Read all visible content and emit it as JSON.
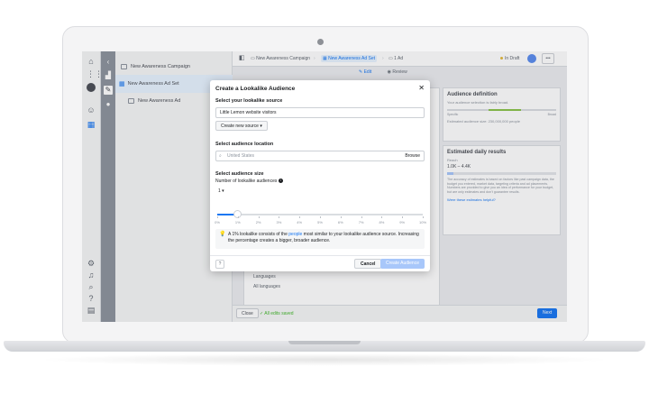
{
  "tree": {
    "campaign": "New Awareness Campaign",
    "adset": "New Awareness Ad Set",
    "ad": "New Awareness Ad"
  },
  "topbar": {
    "crumb_campaign": "New Awareness Campaign",
    "crumb_adset": "New Awareness Ad Set",
    "crumb_ad": "1 Ad",
    "status": "In Draft",
    "more": "•••"
  },
  "tabs": {
    "edit": "Edit",
    "review": "Review"
  },
  "editor": {
    "languages_label": "Languages",
    "languages_value": "All languages"
  },
  "audience_definition": {
    "title": "Audience definition",
    "text": "Your audience selection is fairly broad.",
    "left_end": "Specific",
    "right_end": "Broad",
    "size": "Estimated audience size: 230,000,000 people"
  },
  "daily_results": {
    "title": "Estimated daily results",
    "reach_label": "Reach",
    "reach_value": "1.0K – 4.4K",
    "note": "The accuracy of estimates is based on factors like past campaign data, the budget you entered, market data, targeting criteria and ad placements. Numbers are provided to give you an idea of performance for your budget, but are only estimates and don't guarantee results.",
    "link": "Were these estimates helpful?"
  },
  "bottombar": {
    "close": "Close",
    "saved": "✓ All edits saved",
    "next": "Next"
  },
  "modal": {
    "title": "Create a Lookalike Audience",
    "close": "✕",
    "source_label": "Select your lookalike source",
    "source_value": "Little Lemon website visitors",
    "create_new": "Create new source ▾",
    "location_label": "Select audience location",
    "location_value": "United States",
    "browse": "Browse",
    "size_label": "Select audience size",
    "number_label": "Number of lookalike audiences",
    "number_value": "1 ▾",
    "ticks": [
      "0%",
      "1%",
      "2%",
      "3%",
      "4%",
      "5%",
      "6%",
      "7%",
      "8%",
      "9%",
      "10%"
    ],
    "slider_value_percent": 1,
    "info_prefix": "A 1% lookalike consists of the ",
    "info_link": "people",
    "info_suffix": " most similar to your lookalike audience source. Increasing the percentage creates a bigger, broader audience.",
    "help": "?",
    "cancel": "Cancel",
    "create": "Create Audience"
  },
  "colors": {
    "accent": "#1877f2",
    "disabled_button": "#a8c7fa",
    "draft_dot": "#e2b93b",
    "saved": "#42b72a",
    "dark_rail": "#8d949e"
  }
}
